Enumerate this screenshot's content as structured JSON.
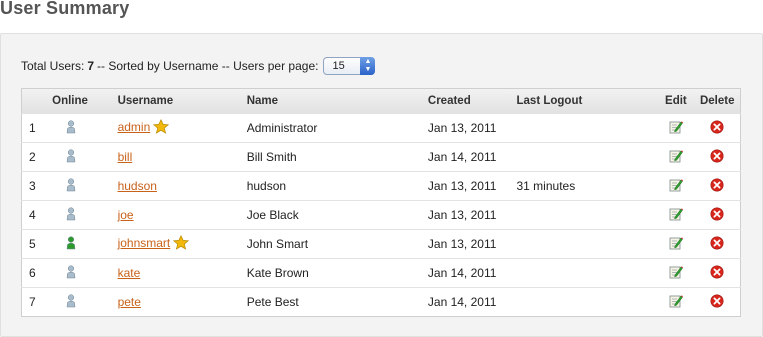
{
  "page": {
    "title": "User Summary"
  },
  "summary": {
    "total_label": "Total Users:",
    "total_count": "7",
    "sort_text": "-- Sorted by Username -- Users per page:",
    "per_page": "15"
  },
  "table": {
    "headers": {
      "online": "Online",
      "username": "Username",
      "name": "Name",
      "created": "Created",
      "last_logout": "Last Logout",
      "edit": "Edit",
      "delete": "Delete"
    },
    "rows": [
      {
        "num": "1",
        "online": false,
        "username": "admin",
        "admin": true,
        "name": "Administrator",
        "created": "Jan 13, 2011",
        "last_logout": ""
      },
      {
        "num": "2",
        "online": false,
        "username": "bill",
        "admin": false,
        "name": "Bill Smith",
        "created": "Jan 14, 2011",
        "last_logout": ""
      },
      {
        "num": "3",
        "online": false,
        "username": "hudson",
        "admin": false,
        "name": "hudson",
        "created": "Jan 13, 2011",
        "last_logout": "31 minutes"
      },
      {
        "num": "4",
        "online": false,
        "username": "joe",
        "admin": false,
        "name": "Joe Black",
        "created": "Jan 13, 2011",
        "last_logout": ""
      },
      {
        "num": "5",
        "online": true,
        "username": "johnsmart",
        "admin": true,
        "name": "John Smart",
        "created": "Jan 13, 2011",
        "last_logout": ""
      },
      {
        "num": "6",
        "online": false,
        "username": "kate",
        "admin": false,
        "name": "Kate Brown",
        "created": "Jan 14, 2011",
        "last_logout": ""
      },
      {
        "num": "7",
        "online": false,
        "username": "pete",
        "admin": false,
        "name": "Pete Best",
        "created": "Jan 14, 2011",
        "last_logout": ""
      }
    ]
  },
  "icons": {
    "online": "user-online-icon",
    "offline": "user-offline-icon",
    "admin": "star-icon",
    "edit": "edit-icon",
    "delete": "delete-icon"
  },
  "colors": {
    "link": "#c8621b",
    "online_user": "#2e9a2e",
    "offline_user": "#a9bccb",
    "star": "#f2b90c",
    "delete": "#d9261c"
  }
}
